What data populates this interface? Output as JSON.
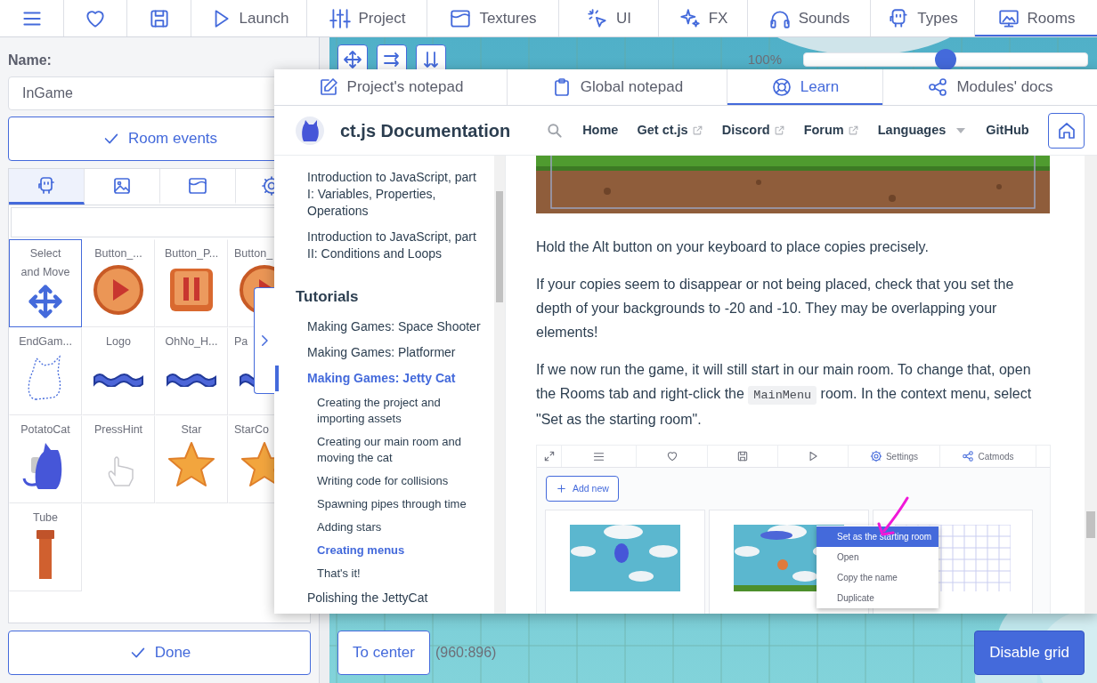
{
  "top_tabs": [
    {
      "selected": false
    },
    {
      "selected": false
    },
    {
      "selected": false
    },
    {
      "label": "Launch",
      "selected": false
    },
    {
      "label": "Project",
      "selected": false
    },
    {
      "label": "Textures",
      "selected": false
    },
    {
      "label": "UI",
      "selected": false
    },
    {
      "label": "FX",
      "selected": false
    },
    {
      "label": "Sounds",
      "selected": false
    },
    {
      "label": "Types",
      "selected": false
    },
    {
      "label": "Rooms",
      "selected": true
    }
  ],
  "room_panel": {
    "name_label": "Name:",
    "name_value": "InGame",
    "events_button": "Room events",
    "library_tabs": [
      {
        "selected": true
      },
      {
        "selected": false
      },
      {
        "selected": false
      },
      {
        "selected": false
      }
    ],
    "items": [
      {
        "label": "Select and Move",
        "selected": true
      },
      {
        "label": "Button_...",
        "selected": false
      },
      {
        "label": "Button_P...",
        "selected": false
      },
      {
        "label": "Button_",
        "selected": false
      },
      {
        "label": "EndGam...",
        "selected": false
      },
      {
        "label": "Logo",
        "selected": false
      },
      {
        "label": "OhNo_H...",
        "selected": false
      },
      {
        "label": "Pa",
        "selected": false
      },
      {
        "label": "PotatoCat",
        "selected": false
      },
      {
        "label": "PressHint",
        "selected": false
      },
      {
        "label": "Star",
        "selected": false
      },
      {
        "label": "StarCo",
        "selected": false
      },
      {
        "label": "Tube",
        "selected": false
      }
    ],
    "done_button": "Done"
  },
  "canvas": {
    "zoom_label": "100%",
    "zoom": {
      "level": 0.5
    },
    "center_button": "To center",
    "coordinates": "(960:896)",
    "grid_button": "Disable grid"
  },
  "notepad": {
    "tabs": [
      {
        "label": "Project's notepad",
        "selected": false
      },
      {
        "label": "Global notepad",
        "selected": false
      },
      {
        "label": "Learn",
        "selected": true
      },
      {
        "label": "Modules' docs",
        "selected": false
      }
    ],
    "docs": {
      "title": "ct.js Documentation",
      "nav": [
        {
          "label": "Home",
          "kind": "link"
        },
        {
          "label": "Get ct.js",
          "kind": "external"
        },
        {
          "label": "Discord",
          "kind": "external"
        },
        {
          "label": "Forum",
          "kind": "external"
        },
        {
          "label": "Languages",
          "kind": "dropdown"
        },
        {
          "label": "GitHub",
          "kind": "link"
        }
      ],
      "sidebar": [
        {
          "label": "Introduction to JavaScript, part I: Variables, Properties, Operations",
          "kind": "page",
          "selected": false
        },
        {
          "label": "Introduction to JavaScript, part II: Conditions and Loops",
          "kind": "page",
          "selected": false
        },
        {
          "label": "Tutorials",
          "kind": "heading"
        },
        {
          "label": "Making Games: Space Shooter",
          "kind": "page",
          "selected": false
        },
        {
          "label": "Making Games: Platformer",
          "kind": "page",
          "selected": false
        },
        {
          "label": "Making Games: Jetty Cat",
          "kind": "page",
          "selected": true,
          "children": [
            {
              "label": "Creating the project and importing assets",
              "selected": false
            },
            {
              "label": "Creating our main room and moving the cat",
              "selected": false
            },
            {
              "label": "Writing code for collisions",
              "selected": false
            },
            {
              "label": "Spawning pipes through time",
              "selected": false
            },
            {
              "label": "Adding stars",
              "selected": false
            },
            {
              "label": "Creating menus",
              "selected": true
            },
            {
              "label": "That's it!",
              "selected": false
            }
          ]
        },
        {
          "label": "Polishing the JettyCat",
          "kind": "page",
          "selected": false
        }
      ],
      "paragraphs": [
        [
          {
            "kind": "text",
            "text": "Hold the Alt button on your keyboard to place copies precisely."
          }
        ],
        [
          {
            "kind": "text",
            "text": "If your copies seem to disappear or not being placed, check that you set the depth of your backgrounds to -20 and -10. They may be overlapping your elements!"
          }
        ],
        [
          {
            "kind": "text",
            "text": "If we now run the game, it will still start in our main room. To change that, open the Rooms tab and right-click the "
          },
          {
            "kind": "code",
            "text": "MainMenu"
          },
          {
            "kind": "text",
            "text": " room. In the context menu, select \"Set as the starting room\"."
          }
        ]
      ],
      "screenshot": {
        "toolbar_labels": [
          "Settings",
          "Catmods"
        ],
        "add_button": "Add new",
        "context_menu": [
          {
            "label": "Set as the starting room",
            "selected": true
          },
          {
            "label": "Open",
            "selected": false
          },
          {
            "label": "Copy the name",
            "selected": false
          },
          {
            "label": "Duplicate",
            "selected": false
          }
        ]
      }
    }
  }
}
